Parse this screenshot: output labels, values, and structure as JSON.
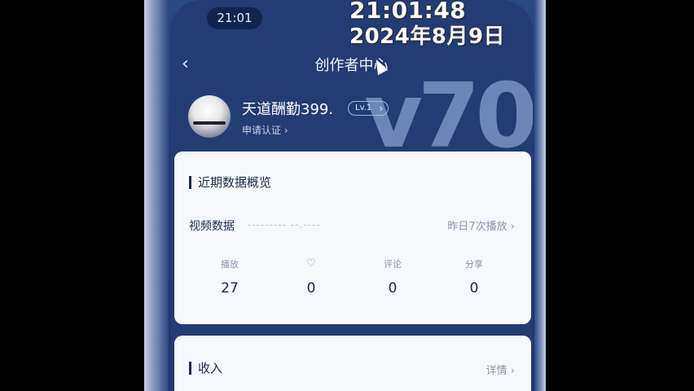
{
  "status_bar": {
    "time": "21:01"
  },
  "timestamp_overlay": {
    "time": "21:01:48",
    "date": "2024年8月9日"
  },
  "nav": {
    "back_icon": "chevron-left-icon",
    "title": "创作者中心"
  },
  "profile": {
    "username": "天道酬勤399.",
    "level": "Lv.1",
    "verify_label": "申请认证 ›",
    "deco_text": "v70"
  },
  "overview_card": {
    "title": "近期数据概览",
    "video_label": "视频数据",
    "video_sub": "--------- --.----",
    "video_link": "昨日7次播放 ›",
    "stats": [
      {
        "label": "播放",
        "value": "27"
      },
      {
        "label": "",
        "icon": "heart-icon",
        "value": "0"
      },
      {
        "label": "评论",
        "value": "0"
      },
      {
        "label": "分享",
        "value": "0"
      }
    ]
  },
  "income_card": {
    "title": "收入",
    "detail_link": "详情 ›"
  }
}
